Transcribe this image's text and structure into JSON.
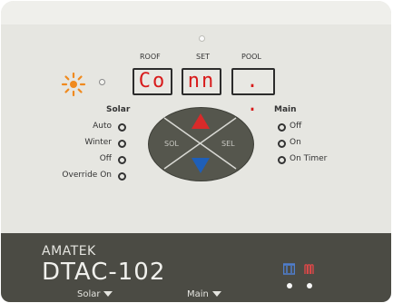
{
  "displays": {
    "roof": {
      "label": "ROOF",
      "value": "Co"
    },
    "set": {
      "label": "SET",
      "value": "nn"
    },
    "pool": {
      "label": "POOL",
      "value": ". ."
    }
  },
  "solar": {
    "title": "Solar",
    "options": [
      "Auto",
      "Winter",
      "Off",
      "Override On"
    ]
  },
  "main": {
    "title": "Main",
    "options": [
      "Off",
      "On",
      "On Timer"
    ]
  },
  "pad": {
    "left_label": "SOL",
    "right_label": "SEL"
  },
  "brand": {
    "name": "AMATEK",
    "model": "DTAC-102"
  },
  "tabs": {
    "solar": "Solar",
    "main": "Main"
  },
  "icons": {
    "sun": "sun-icon",
    "pump": "pump-icon",
    "heater": "heater-icon"
  },
  "colors": {
    "display_text": "#d81b1b",
    "up_arrow": "#d82a2a",
    "down_arrow": "#1f5fb8",
    "sun": "#f08a1e",
    "bottom_bar": "#4b4b44"
  }
}
